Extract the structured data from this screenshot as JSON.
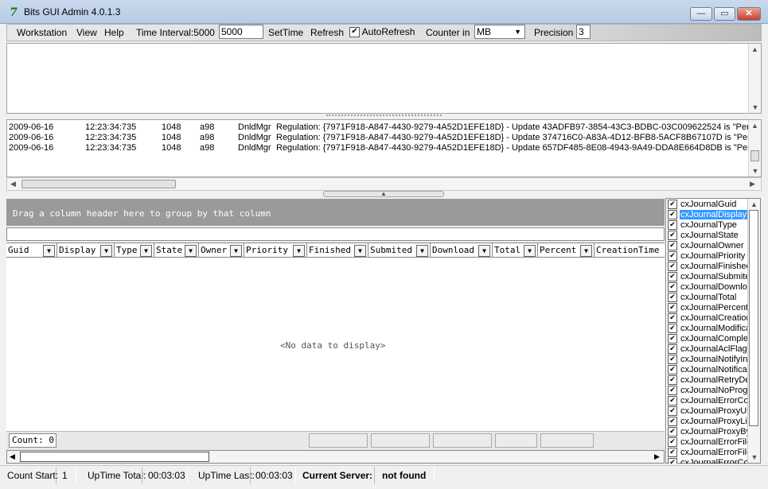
{
  "window": {
    "title": "Bits GUI Admin 4.0.1.3",
    "icon_name": "app-logo-icon",
    "minimize_glyph": "—",
    "maximize_glyph": "▭",
    "close_glyph": "✕"
  },
  "toolbar": {
    "menu": [
      "Workstation",
      "View",
      "Help"
    ],
    "time_interval_label": "Time Interval:5000",
    "time_interval_value": "5000",
    "settime_label": "SetTime",
    "refresh_label": "Refresh",
    "autorefresh_label": "AutoRefresh",
    "autorefresh_checked": true,
    "counter_label": "Counter in",
    "counter_value": "MB",
    "precision_label": "Precision",
    "precision_value": "3"
  },
  "log": {
    "rows": [
      {
        "date": "2009-06-16",
        "time": "12:23:34:735",
        "pid": "1048",
        "tid": "a98",
        "source": "DnldMgr",
        "message": "Regulation: {7971F918-A847-4430-9279-4A52D1EFE18D} - Update 43ADFB97-3854-43C3-BDBC-03C009622524 is \"PerUpd"
      },
      {
        "date": "2009-06-16",
        "time": "12:23:34:735",
        "pid": "1048",
        "tid": "a98",
        "source": "DnldMgr",
        "message": "Regulation: {7971F918-A847-4430-9279-4A52D1EFE18D} - Update 374716C0-A83A-4D12-BFB8-5ACF8B67107D is \"PerUpd"
      },
      {
        "date": "2009-06-16",
        "time": "12:23:34:735",
        "pid": "1048",
        "tid": "a98",
        "source": "DnldMgr",
        "message": "Regulation: {7971F918-A847-4430-9279-4A52D1EFE18D} - Update 657DF485-8E08-4943-9A49-DDA8E664D8DB is \"PerUpd"
      }
    ]
  },
  "grid": {
    "group_hint": "Drag a column header here to group by that column",
    "columns": [
      "Guid",
      "Display",
      "Type",
      "State",
      "Owner",
      "Priority",
      "Finished",
      "Submited",
      "Download",
      "Total",
      "Percent",
      "CreationTime"
    ],
    "empty_text": "<No data to display>",
    "count_text": "Count: 0"
  },
  "column_list": {
    "selected": "cxJournalDisplay",
    "items": [
      "cxJournalGuid",
      "cxJournalDisplay",
      "cxJournalType",
      "cxJournalState",
      "cxJournalOwner",
      "cxJournalPriority",
      "cxJournalFinished",
      "cxJournalSubmited",
      "cxJournalDownload",
      "cxJournalTotal",
      "cxJournalPercent",
      "cxJournalCreation",
      "cxJournalModifica",
      "cxJournalComplet",
      "cxJournalAclFlags",
      "cxJournalNotifyInt",
      "cxJournalNotificat",
      "cxJournalRetryDe",
      "cxJournalNoProgr",
      "cxJournalErrorCo",
      "cxJournalProxyUs",
      "cxJournalProxyLis",
      "cxJournalProxyBy",
      "cxJournalErrorFile",
      "cxJournalErrorFile",
      "cxJournalErrorCo"
    ]
  },
  "status": {
    "count_start_label": "Count Start:",
    "count_start_value": "1",
    "uptime_total_label": "UpTime Total:",
    "uptime_total_value": "00:03:03",
    "uptime_last_label": "UpTime Last:",
    "uptime_last_value": "00:03:03",
    "current_server_label": "Current Server:",
    "current_server_value": "not found"
  },
  "colors": {
    "group_panel_bg": "#9a9a9a",
    "selection": "#3399ff",
    "title_bar": "#c9d9ec",
    "close_button": "#c2412c"
  }
}
